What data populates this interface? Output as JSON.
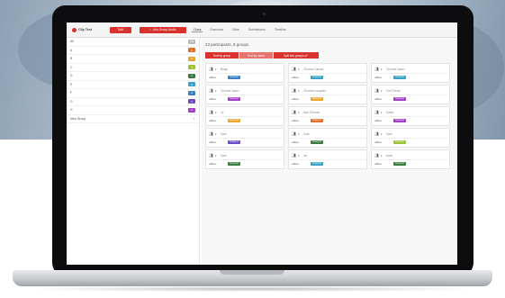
{
  "colors": {
    "brand_red": "#d9322e",
    "sort_group_btn": "#d9322e",
    "sort_name_btn": "#e8746f",
    "split_btn": "#d9322e"
  },
  "topbar": {
    "logo_text": "Clip Test",
    "talk_label": "Talk!",
    "join_label": "Join Group Audio",
    "tabs": [
      {
        "label": "Class",
        "active": true
      },
      {
        "label": "Exercises",
        "active": false
      },
      {
        "label": "Slide",
        "active": false
      },
      {
        "label": "Submissions",
        "active": false
      },
      {
        "label": "Timeline",
        "active": false
      }
    ]
  },
  "sidebar": {
    "groups": [
      {
        "label": "All",
        "count": "23",
        "color": "#b9b9b9"
      },
      {
        "label": "A",
        "count": "2",
        "color": "#e06f2b"
      },
      {
        "label": "B",
        "count": "2",
        "color": "#e9a62e"
      },
      {
        "label": "C",
        "count": "3",
        "color": "#9ac33a"
      },
      {
        "label": "D",
        "count": "3",
        "color": "#3a7c3f"
      },
      {
        "label": "E",
        "count": "3",
        "color": "#3aa1c4"
      },
      {
        "label": "F",
        "count": "3",
        "color": "#3b7fc1"
      },
      {
        "label": "G",
        "count": "3",
        "color": "#6c4cc2"
      },
      {
        "label": "H",
        "count": "2",
        "color": "#a13fc4"
      }
    ],
    "new_group_label": "New Group",
    "plus": "+"
  },
  "main": {
    "summary": "23 participants, 8 groups.",
    "sort_group_label": "Sort by group",
    "sort_name_label": "Sort by name",
    "split_label": "Split into groups of ·",
    "cards": [
      {
        "name": "Bingo",
        "status": "offline",
        "group": "Group F",
        "color": "#3b7fc1"
      },
      {
        "name": "Chrome Canary",
        "status": "offline",
        "group": "Group E",
        "color": "#3aa1c4"
      },
      {
        "name": "Chrome Dawn",
        "status": "offline",
        "group": "Group E",
        "color": "#3aa1c4"
      },
      {
        "name": "Chrome Dawn",
        "status": "offline",
        "group": "Group H",
        "color": "#a13fc4"
      },
      {
        "name": "Chrome Incognito",
        "status": "offline",
        "group": "Group B",
        "color": "#e9a62e"
      },
      {
        "name": "Fox Firefox",
        "status": "offline",
        "group": "Group H",
        "color": "#a13fc4"
      },
      {
        "name": "Jo",
        "status": "offline",
        "group": "Group B",
        "color": "#e9a62e"
      },
      {
        "name": "Mac Chrome",
        "status": "offline",
        "group": "Group A",
        "color": "#e06f2b"
      },
      {
        "name": "Safari",
        "status": "offline",
        "group": "Group H",
        "color": "#a13fc4"
      },
      {
        "name": "User",
        "status": "offline",
        "group": "Group G",
        "color": "#6c4cc2"
      },
      {
        "name": "User",
        "status": "offline",
        "group": "Group D",
        "color": "#3a7c3f"
      },
      {
        "name": "User",
        "status": "offline",
        "group": "Group C",
        "color": "#9ac33a"
      },
      {
        "name": "User",
        "status": "offline",
        "group": "Group D",
        "color": "#3a7c3f"
      },
      {
        "name": "uw",
        "status": "offline",
        "group": "Group E",
        "color": "#3aa1c4"
      },
      {
        "name": "www",
        "status": "offline",
        "group": "Group D",
        "color": "#3a7c3f"
      }
    ]
  }
}
